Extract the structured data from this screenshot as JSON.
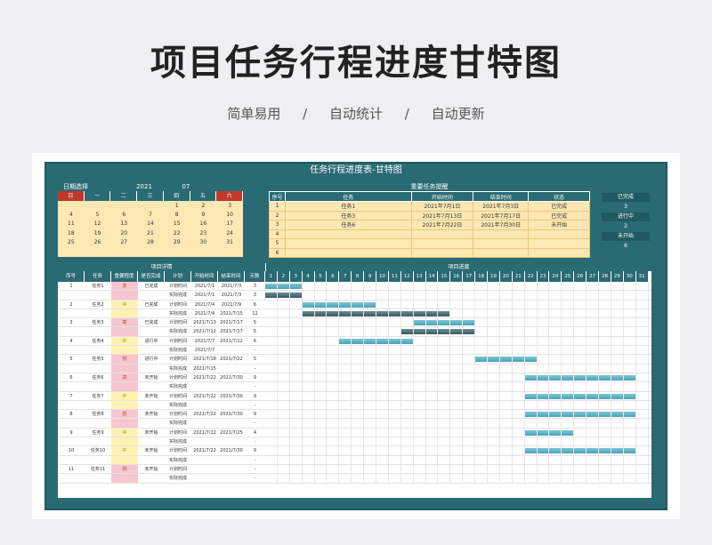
{
  "header": {
    "title": "项目任务行程进度甘特图",
    "subtitle": [
      "简单易用",
      "/",
      "自动统计",
      "/",
      "自动更新"
    ]
  },
  "sheet": {
    "title": "任务行程进度表-甘特图"
  },
  "calendar": {
    "label": "日期选择",
    "year": "2021",
    "month": "07",
    "weekdays": [
      "日",
      "一",
      "二",
      "三",
      "四",
      "五",
      "六"
    ],
    "days": [
      "",
      "",
      "",
      "",
      "1",
      "2",
      "3",
      "4",
      "5",
      "6",
      "7",
      "8",
      "9",
      "10",
      "11",
      "12",
      "13",
      "14",
      "15",
      "16",
      "17",
      "18",
      "19",
      "20",
      "21",
      "22",
      "23",
      "24",
      "25",
      "26",
      "27",
      "28",
      "29",
      "30",
      "31"
    ]
  },
  "reminder": {
    "title": "重要任务提醒",
    "columns": [
      "序号",
      "任务",
      "开始时间",
      "结束时间",
      "状态"
    ],
    "rows": [
      [
        "1",
        "任务1",
        "2021年7月1日",
        "2021年7月3日",
        "已完成"
      ],
      [
        "2",
        "任务3",
        "2021年7月13日",
        "2021年7月17日",
        "已完成"
      ],
      [
        "3",
        "任务6",
        "2021年7月22日",
        "2021年7月30日",
        "未开始"
      ],
      [
        "4",
        "",
        "",
        "",
        ""
      ],
      [
        "5",
        "",
        "",
        "",
        ""
      ],
      [
        "6",
        "",
        "",
        "",
        ""
      ]
    ]
  },
  "stats": [
    {
      "label": "已完成",
      "value": "3"
    },
    {
      "label": "进行中",
      "value": "2"
    },
    {
      "label": "未开始",
      "value": "6"
    }
  ],
  "detail": {
    "left_title": "项目详情",
    "right_title": "项目进度",
    "columns": [
      "序号",
      "任务",
      "重要程度",
      "是否完成",
      "计划",
      "开始时间",
      "结束时间",
      "天数"
    ],
    "day_numbers": [
      "1",
      "2",
      "3",
      "4",
      "5",
      "6",
      "7",
      "8",
      "9",
      "10",
      "11",
      "12",
      "13",
      "14",
      "15",
      "16",
      "17",
      "18",
      "19",
      "20",
      "21",
      "22",
      "23",
      "24",
      "25",
      "26",
      "27",
      "28",
      "29",
      "30",
      "31"
    ]
  },
  "tasks": [
    {
      "no": "1",
      "name": "任务1",
      "imp": "高",
      "done": "已完成",
      "plan": {
        "s": "2021/7/1",
        "e": "2021/7/3",
        "d": "3",
        "bar": [
          1,
          3
        ]
      },
      "real": {
        "s": "2021/7/1",
        "e": "2021/7/3",
        "d": "3",
        "bar": [
          1,
          3
        ]
      }
    },
    {
      "no": "2",
      "name": "任务2",
      "imp": "中",
      "done": "已完成",
      "plan": {
        "s": "2021/7/4",
        "e": "2021/7/9",
        "d": "6",
        "bar": [
          4,
          9
        ]
      },
      "real": {
        "s": "2021/7/4",
        "e": "2021/7/15",
        "d": "12",
        "bar": [
          4,
          15
        ]
      }
    },
    {
      "no": "3",
      "name": "任务3",
      "imp": "高",
      "done": "已完成",
      "plan": {
        "s": "2021/7/13",
        "e": "2021/7/17",
        "d": "5",
        "bar": [
          13,
          17
        ]
      },
      "real": {
        "s": "2021/7/12",
        "e": "2021/7/17",
        "d": "6",
        "bar": [
          12,
          17
        ]
      }
    },
    {
      "no": "4",
      "name": "任务4",
      "imp": "中",
      "done": "进行中",
      "plan": {
        "s": "2021/7/7",
        "e": "2021/7/12",
        "d": "6",
        "bar": [
          7,
          12
        ]
      },
      "real": {
        "s": "2021/7/7",
        "e": "",
        "d": "-",
        "bar": null
      }
    },
    {
      "no": "5",
      "name": "任务5",
      "imp": "低",
      "done": "进行中",
      "plan": {
        "s": "2021/7/18",
        "e": "2021/7/22",
        "d": "5",
        "bar": [
          18,
          22
        ]
      },
      "real": {
        "s": "2021/7/15",
        "e": "",
        "d": "-",
        "bar": null
      }
    },
    {
      "no": "6",
      "name": "任务6",
      "imp": "高",
      "done": "未开始",
      "plan": {
        "s": "2021/7/22",
        "e": "2021/7/30",
        "d": "9",
        "bar": [
          22,
          30
        ]
      },
      "real": {
        "s": "",
        "e": "",
        "d": "-",
        "bar": null
      }
    },
    {
      "no": "7",
      "name": "任务7",
      "imp": "中",
      "done": "未开始",
      "plan": {
        "s": "2021/7/22",
        "e": "2021/7/30",
        "d": "9",
        "bar": [
          22,
          30
        ]
      },
      "real": {
        "s": "",
        "e": "",
        "d": "-",
        "bar": null
      }
    },
    {
      "no": "8",
      "name": "任务8",
      "imp": "低",
      "done": "未开始",
      "plan": {
        "s": "2021/7/22",
        "e": "2021/7/30",
        "d": "9",
        "bar": [
          22,
          30
        ]
      },
      "real": {
        "s": "",
        "e": "",
        "d": "-",
        "bar": null
      }
    },
    {
      "no": "9",
      "name": "任务9",
      "imp": "中",
      "done": "未开始",
      "plan": {
        "s": "2021/7/22",
        "e": "2021/7/25",
        "d": "4",
        "bar": [
          22,
          25
        ]
      },
      "real": {
        "s": "",
        "e": "",
        "d": "-",
        "bar": null
      }
    },
    {
      "no": "10",
      "name": "任务10",
      "imp": "中",
      "done": "未开始",
      "plan": {
        "s": "2021/7/22",
        "e": "2021/7/30",
        "d": "9",
        "bar": [
          22,
          30
        ]
      },
      "real": {
        "s": "",
        "e": "",
        "d": "-",
        "bar": null
      }
    },
    {
      "no": "11",
      "name": "任务11",
      "imp": "低",
      "done": "未开始",
      "plan": {
        "s": "",
        "e": "",
        "d": "-",
        "bar": null
      },
      "real": {
        "s": "",
        "e": "",
        "d": "-",
        "bar": null
      }
    }
  ],
  "labels": {
    "plan": "计划时间",
    "real": "实际完成"
  },
  "colors": {
    "teal": "#2a6a73",
    "high": "#f7c6d0",
    "mid": "#fff2b3",
    "low": "#f7c6d0"
  }
}
